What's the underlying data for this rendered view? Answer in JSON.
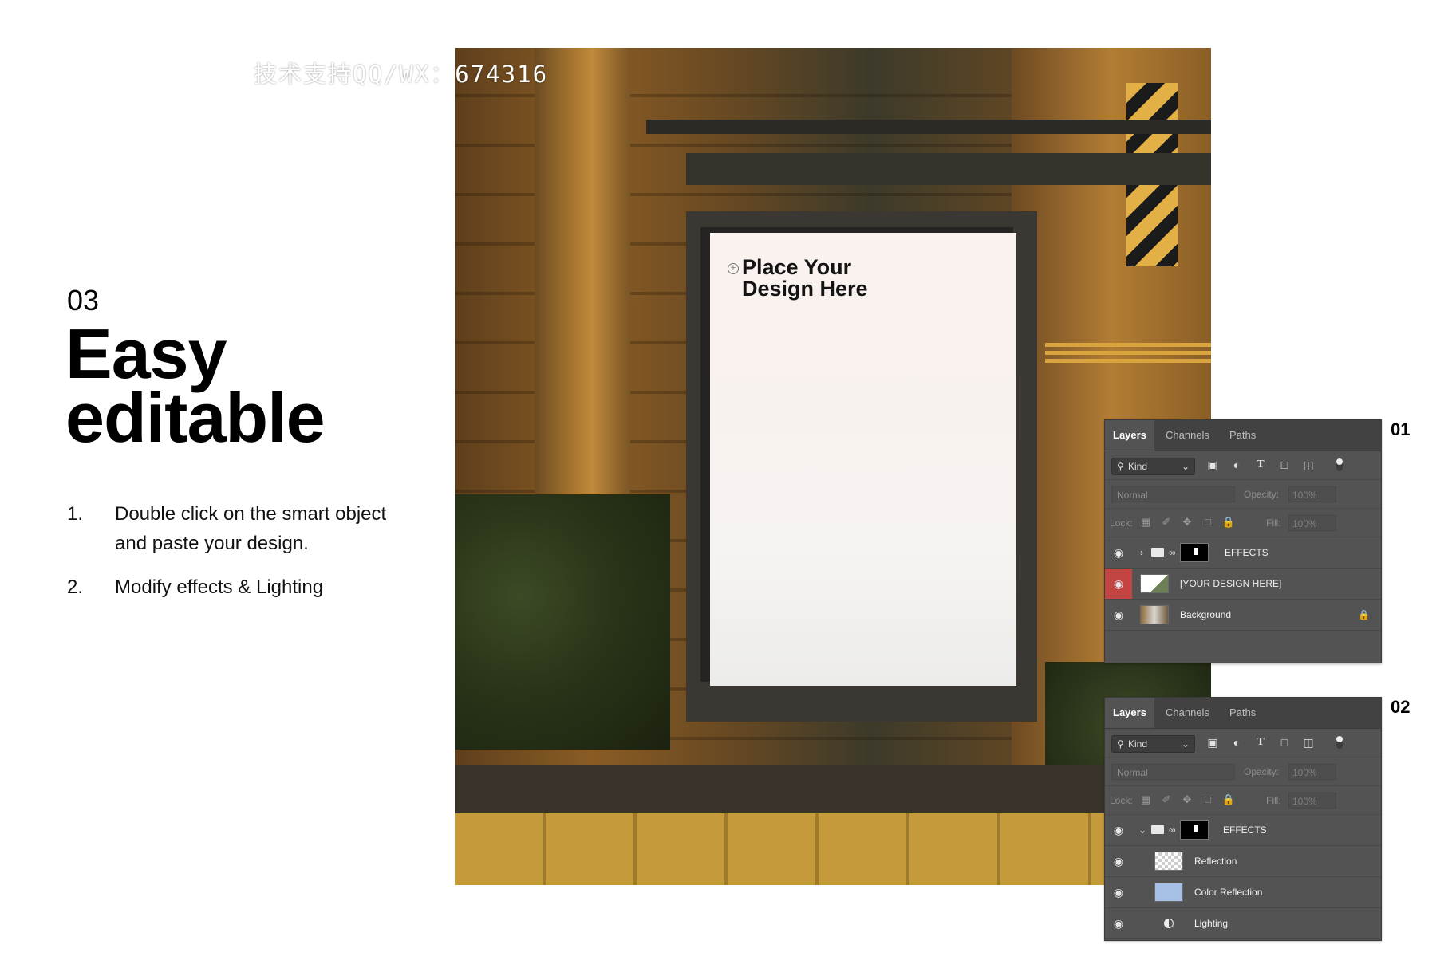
{
  "watermark": "技术支持QQ/WX：674316",
  "step": {
    "number": "03",
    "headline_line1": "Easy",
    "headline_line2": "editable"
  },
  "instructions": [
    {
      "num": "1.",
      "text": "Double click on the smart object and paste your design."
    },
    {
      "num": "2.",
      "text": "Modify effects & Lighting"
    }
  ],
  "poster": {
    "line1": "Place Your",
    "line2": "Design Here"
  },
  "panel1": {
    "number": "01",
    "tabs": [
      "Layers",
      "Channels",
      "Paths"
    ],
    "filter_kind": "Kind",
    "blend_mode": "Normal",
    "opacity_label": "Opacity:",
    "opacity_value": "100%",
    "lock_label": "Lock:",
    "fill_label": "Fill:",
    "fill_value": "100%",
    "layers": [
      {
        "name": "EFFECTS",
        "type": "group-collapsed"
      },
      {
        "name": "[YOUR DESIGN HERE]",
        "type": "smart-object"
      },
      {
        "name": "Background",
        "type": "background"
      }
    ]
  },
  "panel2": {
    "number": "02",
    "tabs": [
      "Layers",
      "Channels",
      "Paths"
    ],
    "filter_kind": "Kind",
    "blend_mode": "Normal",
    "opacity_label": "Opacity:",
    "opacity_value": "100%",
    "lock_label": "Lock:",
    "fill_label": "Fill:",
    "fill_value": "100%",
    "layers": [
      {
        "name": "EFFECTS",
        "type": "group-expanded"
      },
      {
        "name": "Reflection",
        "type": "transparent"
      },
      {
        "name": "Color Reflection",
        "type": "fill",
        "color": "#a7c1e6"
      },
      {
        "name": "Lighting",
        "type": "adjustment"
      }
    ]
  },
  "colors": {
    "panel_bg": "#535353",
    "visibility_selected": "#c24443"
  },
  "icons": [
    "search-icon",
    "image-filter-icon",
    "adjustment-filter-icon",
    "type-filter-icon",
    "shape-filter-icon",
    "smart-object-filter-icon",
    "eye-icon",
    "folder-icon",
    "chain-link-icon",
    "lock-icon"
  ]
}
